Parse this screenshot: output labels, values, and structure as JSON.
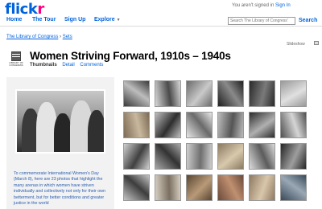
{
  "header": {
    "logo_main": "flick",
    "logo_accent": "r",
    "signin_prefix": "You aren't signed in",
    "signin_link": "Sign In",
    "nav": [
      {
        "label": "Home"
      },
      {
        "label": "The Tour"
      },
      {
        "label": "Sign Up"
      },
      {
        "label": "Explore",
        "caret": "▼"
      }
    ],
    "search_placeholder": "Search The Library of Congress'",
    "search_label": "Search"
  },
  "breadcrumb": {
    "owner": "The Library of Congress",
    "separator": "›",
    "section": "Sets"
  },
  "slideshow_label": "Slideshow",
  "owner_logo_text": "LIBRARY OF CONGRESS",
  "set": {
    "title": "Women Striving Forward, 1910s – 1940s",
    "tabs": {
      "active": "Thumbnails",
      "detail": "Detail",
      "comments": "Comments"
    },
    "description": "To commemorate International Women's Day (March 8), here are 23 photos that highlight the many arenas in which women have striven individually and collectively not only for their own betterment, but for better conditions and greater justice in the world"
  },
  "thumbnails": [
    {
      "name": "thumb-1",
      "c1": "#3a3a3a",
      "c2": "#bdbdbd"
    },
    {
      "name": "thumb-2",
      "c1": "#d8d8d8",
      "c2": "#4a4a4a"
    },
    {
      "name": "thumb-3",
      "c1": "#6b6b6b",
      "c2": "#c9c9c9"
    },
    {
      "name": "thumb-4",
      "c1": "#1f1f1f",
      "c2": "#8a8a8a"
    },
    {
      "name": "thumb-5",
      "c1": "#2a2a2a",
      "c2": "#7a7a7a"
    },
    {
      "name": "thumb-6",
      "c1": "#9a9a9a",
      "c2": "#e0e0e0"
    },
    {
      "name": "thumb-7",
      "c1": "#7d6b55",
      "c2": "#c8b89d"
    },
    {
      "name": "thumb-8",
      "c1": "#c0c0c0",
      "c2": "#2e2e2e"
    },
    {
      "name": "thumb-9",
      "c1": "#e9e9e9",
      "c2": "#6a6a6a"
    },
    {
      "name": "thumb-10",
      "c1": "#bcbcbc",
      "c2": "#555555"
    },
    {
      "name": "thumb-11",
      "c1": "#2c2c2c",
      "c2": "#b0b0b0"
    },
    {
      "name": "thumb-12",
      "c1": "#505050",
      "c2": "#d5d5d5"
    },
    {
      "name": "thumb-13",
      "c1": "#d0d0d0",
      "c2": "#404040"
    },
    {
      "name": "thumb-14",
      "c1": "#a8a8a8",
      "c2": "#333333"
    },
    {
      "name": "thumb-15",
      "c1": "#cfcfcf",
      "c2": "#6f6f6f"
    },
    {
      "name": "thumb-16",
      "c1": "#8b7a60",
      "c2": "#d8c9ad"
    },
    {
      "name": "thumb-17",
      "c1": "#dcdcdc",
      "c2": "#5c5c5c"
    },
    {
      "name": "thumb-18",
      "c1": "#262626",
      "c2": "#9e9e9e"
    },
    {
      "name": "thumb-19",
      "c1": "#c4c4c4",
      "c2": "#3d3d3d"
    },
    {
      "name": "thumb-20",
      "c1": "#d6cfc2",
      "c2": "#7a6f60"
    },
    {
      "name": "thumb-21",
      "c1": "#5a4632",
      "c2": "#b89a78"
    },
    {
      "name": "thumb-22",
      "c1": "#6b4a3a",
      "c2": "#c09070"
    },
    {
      "name": "thumb-23",
      "c1": "#8f7a62",
      "c2": "#d9c7ab"
    },
    {
      "name": "thumb-24",
      "c1": "#3a4a5a",
      "c2": "#9aa8b5"
    }
  ]
}
